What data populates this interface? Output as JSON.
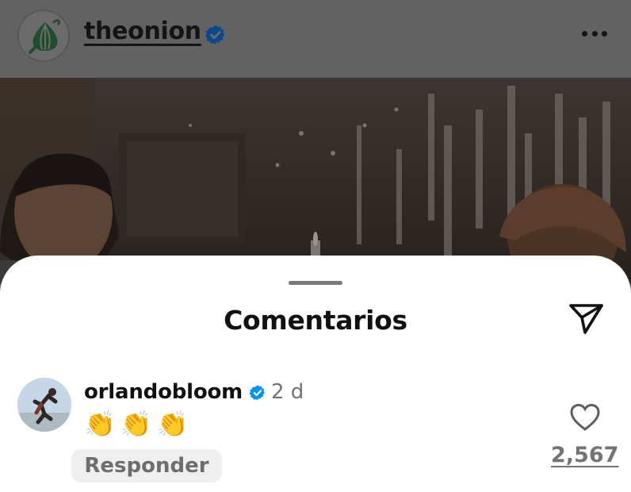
{
  "post": {
    "username": "theonion",
    "avatar_icon": "onion-logo-icon",
    "verified_icon": "verified-badge-icon",
    "more_icon": "more-options-icon"
  },
  "sheet": {
    "title": "Comentarios",
    "share_icon": "send-icon"
  },
  "comment": {
    "username": "orlandobloom",
    "time": "2 d",
    "text": "👏👏👏",
    "reply_label": "Responder",
    "like_icon": "heart-outline-icon",
    "like_count": "2,567"
  },
  "colors": {
    "overlay": "#5c5c5c",
    "verified_blue": "#0095f6",
    "onion_green": "#1f4d2e",
    "muted_text": "#737373"
  }
}
